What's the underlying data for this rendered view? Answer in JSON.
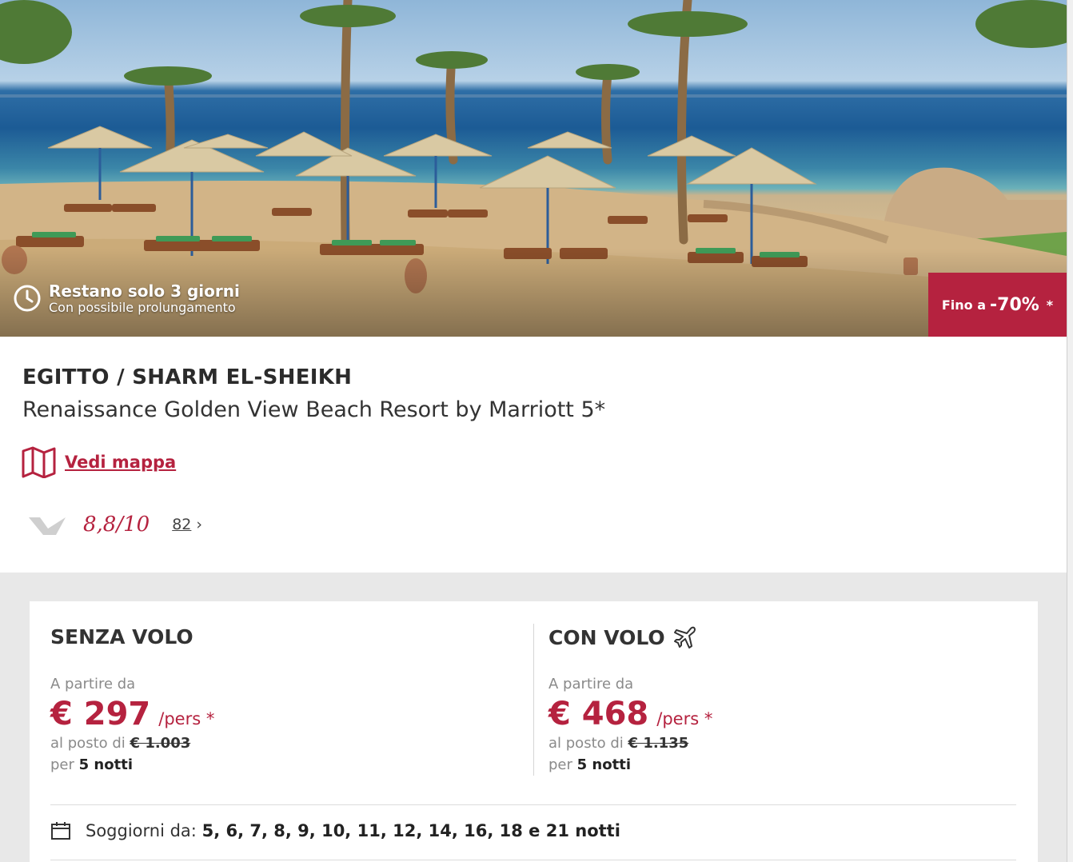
{
  "hero": {
    "image_alt": "Beach with straw umbrellas, sun loungers and palm trees by the sea",
    "timer_title": "Restano solo 3 giorni",
    "timer_subtitle": "Con possibile prolungamento",
    "discount_label": "Fino a",
    "discount_value": "-70%",
    "discount_asterisk": "*"
  },
  "offer": {
    "destination": "EGITTO / SHARM EL-SHEIKH",
    "hotel_name": "Renaissance Golden View Beach Resort by Marriott 5*",
    "map_link": "Vedi mappa",
    "rating_score": "8,8/10",
    "review_count": "82"
  },
  "pricing": {
    "without_flight": {
      "title": "SENZA VOLO",
      "from_label": "A partire da",
      "price": "€ 297",
      "unit": "/pers *",
      "was_label": "al posto di",
      "was_price": "€ 1.003",
      "nights_prefix": "per",
      "nights": "5 notti"
    },
    "with_flight": {
      "title": "CON VOLO",
      "from_label": "A partire da",
      "price": "€ 468",
      "unit": "/pers *",
      "was_label": "al posto di",
      "was_price": "€ 1.135",
      "nights_prefix": "per",
      "nights": "5 notti"
    },
    "stays_label": "Soggiorni da:",
    "stays_values": "5, 6, 7, 8, 9, 10, 11, 12, 14, 16, 18 e 21 notti"
  },
  "colors": {
    "accent": "#b5223f",
    "background_gray": "#e8e8e8",
    "text_dark": "#333333",
    "text_muted": "#8a8a8a"
  },
  "icons": [
    "clock-icon",
    "map-icon",
    "rating-logo-icon",
    "chevron-right-icon",
    "airplane-icon",
    "calendar-icon"
  ]
}
